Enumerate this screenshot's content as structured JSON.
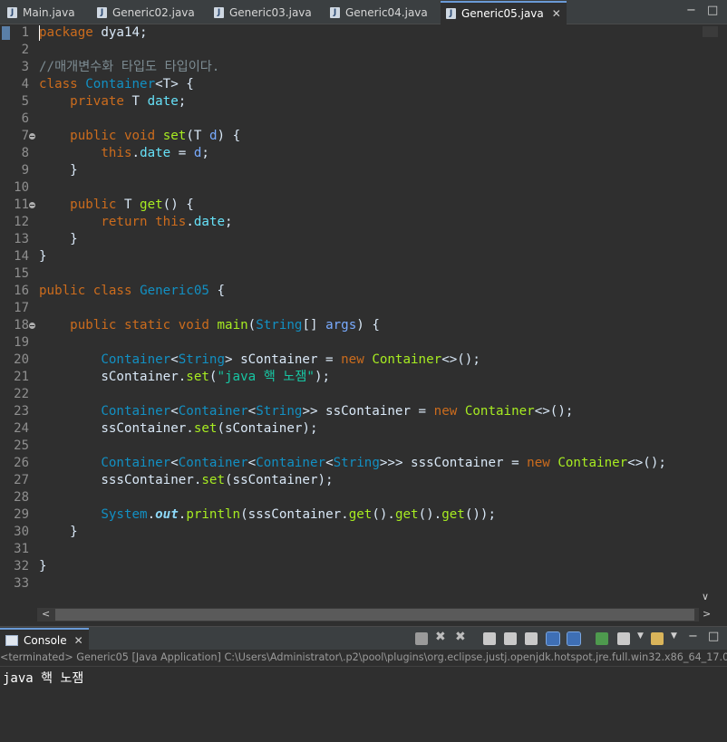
{
  "editor_tabs": [
    {
      "label": "Main.java"
    },
    {
      "label": "Generic02.java"
    },
    {
      "label": "Generic03.java"
    },
    {
      "label": "Generic04.java"
    },
    {
      "label": "Generic05.java",
      "active": true
    }
  ],
  "code_lines": [
    {
      "n": "1",
      "tokens": [
        [
          "kw",
          "package"
        ],
        [
          "txt",
          " dya14;"
        ]
      ]
    },
    {
      "n": "2",
      "tokens": []
    },
    {
      "n": "3",
      "tokens": [
        [
          "cm",
          "//매개변수화 타입도 타입이다."
        ]
      ]
    },
    {
      "n": "4",
      "tokens": [
        [
          "kw",
          "class"
        ],
        [
          "txt",
          " "
        ],
        [
          "ty",
          "Container"
        ],
        [
          "txt",
          "<T> {"
        ]
      ]
    },
    {
      "n": "5",
      "tokens": [
        [
          "txt",
          "    "
        ],
        [
          "kw",
          "private"
        ],
        [
          "txt",
          " T "
        ],
        [
          "fld",
          "date"
        ],
        [
          "txt",
          ";"
        ]
      ]
    },
    {
      "n": "6",
      "tokens": []
    },
    {
      "n": "7",
      "fold": true,
      "tokens": [
        [
          "txt",
          "    "
        ],
        [
          "kw",
          "public"
        ],
        [
          "txt",
          " "
        ],
        [
          "kw",
          "void"
        ],
        [
          "txt",
          " "
        ],
        [
          "fn",
          "set"
        ],
        [
          "txt",
          "(T "
        ],
        [
          "par",
          "d"
        ],
        [
          "txt",
          ") {"
        ]
      ]
    },
    {
      "n": "8",
      "tokens": [
        [
          "txt",
          "        "
        ],
        [
          "kw",
          "this"
        ],
        [
          "txt",
          "."
        ],
        [
          "fld",
          "date"
        ],
        [
          "txt",
          " = "
        ],
        [
          "par",
          "d"
        ],
        [
          "txt",
          ";"
        ]
      ]
    },
    {
      "n": "9",
      "tokens": [
        [
          "txt",
          "    }"
        ]
      ]
    },
    {
      "n": "10",
      "tokens": []
    },
    {
      "n": "11",
      "fold": true,
      "tokens": [
        [
          "txt",
          "    "
        ],
        [
          "kw",
          "public"
        ],
        [
          "txt",
          " T "
        ],
        [
          "fn",
          "get"
        ],
        [
          "txt",
          "() {"
        ]
      ]
    },
    {
      "n": "12",
      "tokens": [
        [
          "txt",
          "        "
        ],
        [
          "kw",
          "return"
        ],
        [
          "txt",
          " "
        ],
        [
          "kw",
          "this"
        ],
        [
          "txt",
          "."
        ],
        [
          "fld",
          "date"
        ],
        [
          "txt",
          ";"
        ]
      ]
    },
    {
      "n": "13",
      "tokens": [
        [
          "txt",
          "    }"
        ]
      ]
    },
    {
      "n": "14",
      "tokens": [
        [
          "txt",
          "}"
        ]
      ]
    },
    {
      "n": "15",
      "tokens": []
    },
    {
      "n": "16",
      "tokens": [
        [
          "kw",
          "public"
        ],
        [
          "txt",
          " "
        ],
        [
          "kw",
          "class"
        ],
        [
          "txt",
          " "
        ],
        [
          "ty",
          "Generic05"
        ],
        [
          "txt",
          " {"
        ]
      ]
    },
    {
      "n": "17",
      "tokens": []
    },
    {
      "n": "18",
      "fold": true,
      "tokens": [
        [
          "txt",
          "    "
        ],
        [
          "kw",
          "public"
        ],
        [
          "txt",
          " "
        ],
        [
          "kw",
          "static"
        ],
        [
          "txt",
          " "
        ],
        [
          "kw",
          "void"
        ],
        [
          "txt",
          " "
        ],
        [
          "fn",
          "main"
        ],
        [
          "txt",
          "("
        ],
        [
          "ty",
          "String"
        ],
        [
          "txt",
          "[] "
        ],
        [
          "par",
          "args"
        ],
        [
          "txt",
          ") {"
        ]
      ]
    },
    {
      "n": "19",
      "tokens": []
    },
    {
      "n": "20",
      "tokens": [
        [
          "txt",
          "        "
        ],
        [
          "ty",
          "Container"
        ],
        [
          "txt",
          "<"
        ],
        [
          "ty",
          "String"
        ],
        [
          "txt",
          "> sContainer = "
        ],
        [
          "kw",
          "new"
        ],
        [
          "txt",
          " "
        ],
        [
          "fn",
          "Container"
        ],
        [
          "txt",
          "<>();"
        ]
      ]
    },
    {
      "n": "21",
      "tokens": [
        [
          "txt",
          "        sContainer."
        ],
        [
          "fn",
          "set"
        ],
        [
          "txt",
          "("
        ],
        [
          "str",
          "\"java 핵 노잼\""
        ],
        [
          "txt",
          ");"
        ]
      ]
    },
    {
      "n": "22",
      "tokens": []
    },
    {
      "n": "23",
      "tokens": [
        [
          "txt",
          "        "
        ],
        [
          "ty",
          "Container"
        ],
        [
          "txt",
          "<"
        ],
        [
          "ty",
          "Container"
        ],
        [
          "txt",
          "<"
        ],
        [
          "ty",
          "String"
        ],
        [
          "txt",
          ">> ssContainer = "
        ],
        [
          "kw",
          "new"
        ],
        [
          "txt",
          " "
        ],
        [
          "fn",
          "Container"
        ],
        [
          "txt",
          "<>();"
        ]
      ]
    },
    {
      "n": "24",
      "tokens": [
        [
          "txt",
          "        ssContainer."
        ],
        [
          "fn",
          "set"
        ],
        [
          "txt",
          "(sContainer);"
        ]
      ]
    },
    {
      "n": "25",
      "tokens": []
    },
    {
      "n": "26",
      "tokens": [
        [
          "txt",
          "        "
        ],
        [
          "ty",
          "Container"
        ],
        [
          "txt",
          "<"
        ],
        [
          "ty",
          "Container"
        ],
        [
          "txt",
          "<"
        ],
        [
          "ty",
          "Container"
        ],
        [
          "txt",
          "<"
        ],
        [
          "ty",
          "String"
        ],
        [
          "txt",
          ">>> sssContainer = "
        ],
        [
          "kw",
          "new"
        ],
        [
          "txt",
          " "
        ],
        [
          "fn",
          "Container"
        ],
        [
          "txt",
          "<>();"
        ]
      ]
    },
    {
      "n": "27",
      "tokens": [
        [
          "txt",
          "        sssContainer."
        ],
        [
          "fn",
          "set"
        ],
        [
          "txt",
          "(ssContainer);"
        ]
      ]
    },
    {
      "n": "28",
      "tokens": []
    },
    {
      "n": "29",
      "tokens": [
        [
          "txt",
          "        "
        ],
        [
          "ty",
          "System"
        ],
        [
          "txt",
          "."
        ],
        [
          "stc",
          "out"
        ],
        [
          "txt",
          "."
        ],
        [
          "fn",
          "println"
        ],
        [
          "txt",
          "(sssContainer."
        ],
        [
          "fn",
          "get"
        ],
        [
          "txt",
          "()."
        ],
        [
          "fn",
          "get"
        ],
        [
          "txt",
          "()."
        ],
        [
          "fn",
          "get"
        ],
        [
          "txt",
          "());"
        ]
      ]
    },
    {
      "n": "30",
      "tokens": [
        [
          "txt",
          "    }"
        ]
      ]
    },
    {
      "n": "31",
      "tokens": []
    },
    {
      "n": "32",
      "tokens": [
        [
          "txt",
          "}"
        ]
      ]
    },
    {
      "n": "33",
      "tokens": []
    }
  ],
  "console": {
    "tab_label": "Console",
    "status": "<terminated> Generic05 [Java Application] C:\\Users\\Administrator\\.p2\\pool\\plugins\\org.eclipse.justj.openjdk.hotspot.jre.full.win32.x86_64_17.0.",
    "output": "java 핵 노잼"
  },
  "colors": {
    "background": "#2f2f2f",
    "keyword": "#cc6c1d",
    "type": "#1290c3",
    "method": "#a7ec21",
    "field": "#66e1f8",
    "string": "#17c6a3",
    "comment": "#7d8c93"
  }
}
